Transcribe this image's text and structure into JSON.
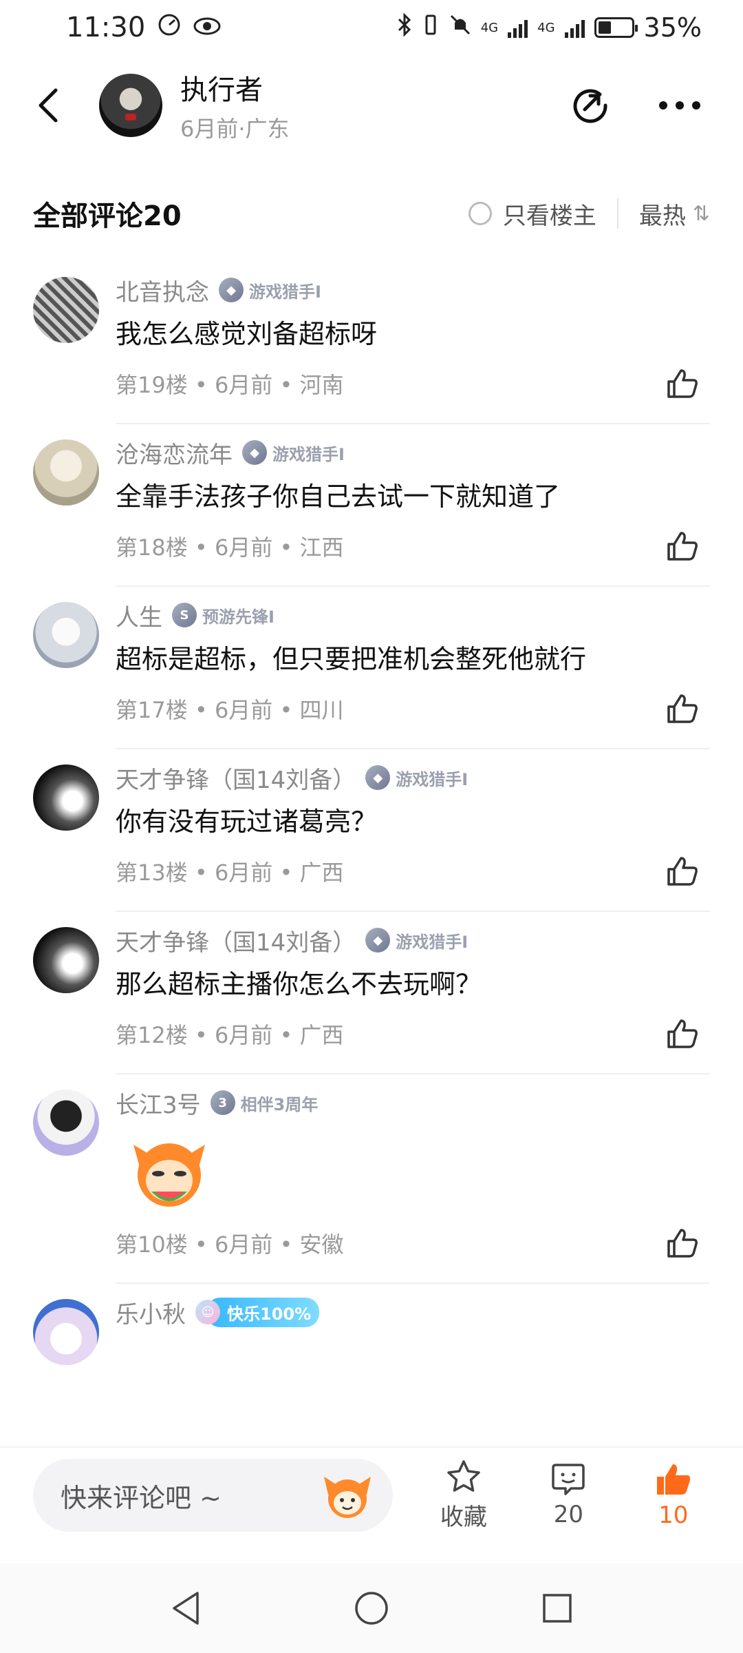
{
  "status_bar": {
    "time": "11:30",
    "battery_pct": "35%",
    "net1": "4G",
    "net2": "4G"
  },
  "header": {
    "author_name": "执行者",
    "author_meta": "6月前·广东"
  },
  "comments_section": {
    "title": "全部评论20",
    "filter_label": "只看楼主",
    "sort_label": "最热"
  },
  "comments": [
    {
      "user": "北音执念",
      "badge": "游戏猎手I",
      "text": "我怎么感觉刘备超标呀",
      "meta": "第19楼 • 6月前 • 河南"
    },
    {
      "user": "沧海恋流年",
      "badge": "游戏猎手I",
      "text": "全靠手法孩子你自己去试一下就知道了",
      "meta": "第18楼 • 6月前 • 江西"
    },
    {
      "user": "人生",
      "badge": "预游先锋I",
      "text": "超标是超标，但只要把准机会整死他就行",
      "meta": "第17楼 • 6月前 • 四川"
    },
    {
      "user": "天才争锋（国14刘备）",
      "badge": "游戏猎手I",
      "text": "你有没有玩过诸葛亮？",
      "meta": "第13楼 • 6月前 • 广西"
    },
    {
      "user": "天才争锋（国14刘备）",
      "badge": "游戏猎手I",
      "text": "那么超标主播你怎么不去玩啊？",
      "meta": "第12楼 • 6月前 • 广西"
    },
    {
      "user": "长江3号",
      "badge": "相伴3周年",
      "text": "",
      "meta": "第10楼 • 6月前 • 安徽"
    },
    {
      "user": "乐小秋",
      "badge": "快乐100%",
      "text": "",
      "meta": ""
    }
  ],
  "bottom_bar": {
    "input_placeholder": "快来评论吧 ~",
    "fav_label": "收藏",
    "comment_count": "20",
    "like_count": "10"
  },
  "colors": {
    "accent": "#ff6a1a",
    "muted": "#9a9a9a"
  }
}
